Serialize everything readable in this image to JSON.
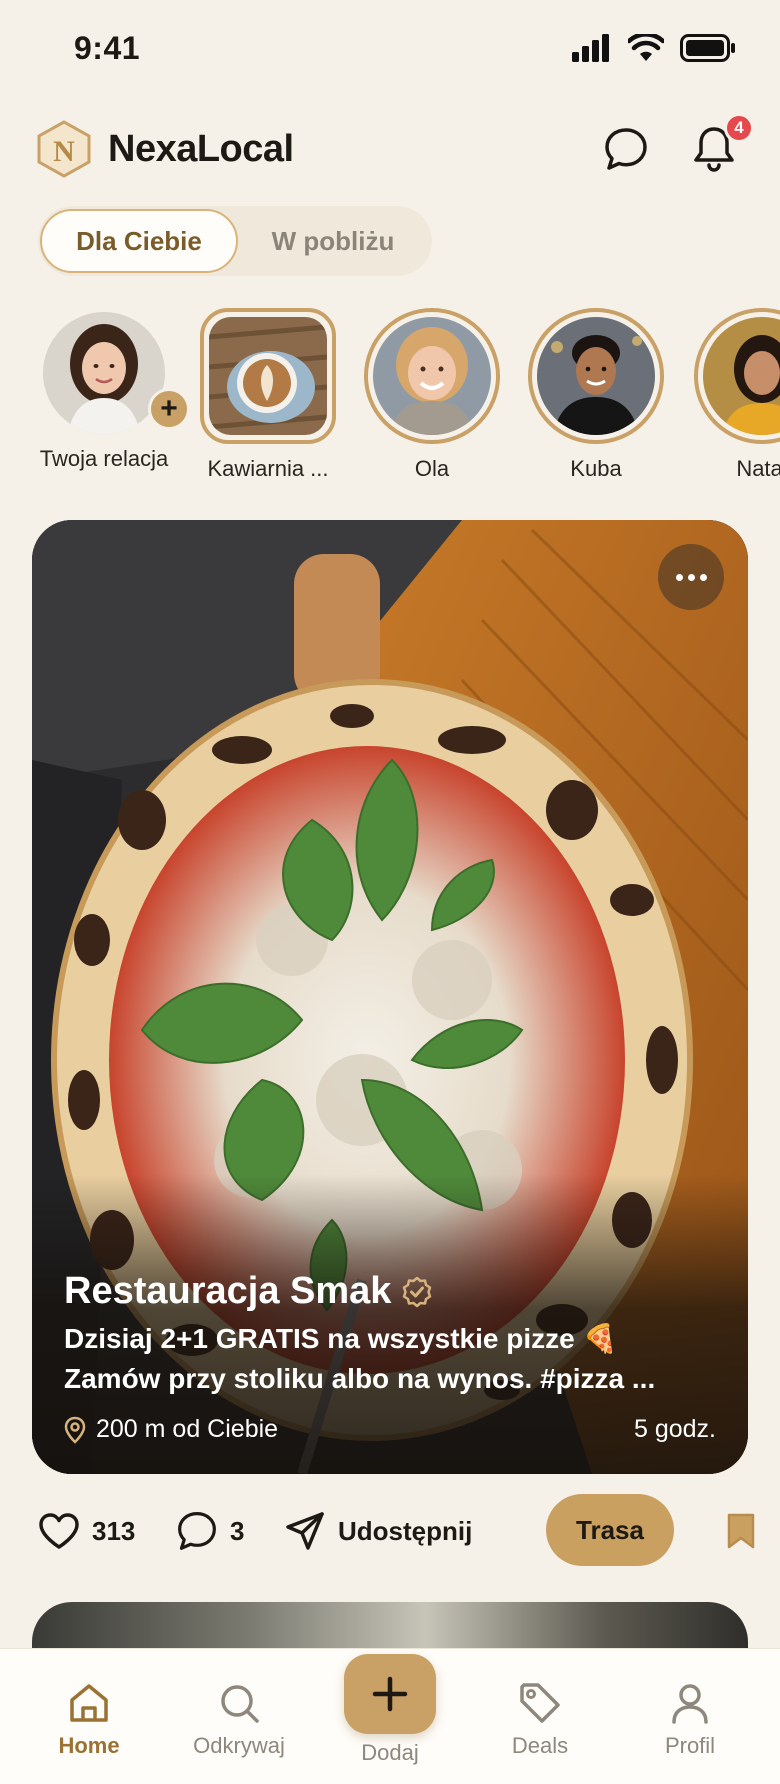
{
  "status_bar": {
    "time": "9:41"
  },
  "header": {
    "app_name": "NexaLocal",
    "logo_letter": "N",
    "notifications_count": "4"
  },
  "tabs": [
    {
      "label": "Dla Ciebie",
      "active": true
    },
    {
      "label": "W pobliżu",
      "active": false
    }
  ],
  "stories": [
    {
      "label": "Twoja relacja",
      "own": true
    },
    {
      "label": "Kawiarnia ..."
    },
    {
      "label": "Ola"
    },
    {
      "label": "Kuba"
    },
    {
      "label": "Natal"
    }
  ],
  "post": {
    "title": "Restauracja Smak",
    "line1": "Dzisiaj 2+1 GRATIS na wszystkie pizze 🍕",
    "line2": "Zamów przy stoliku albo na wynos. #pizza ...",
    "distance": "200 m od Ciebie",
    "time_ago": "5 godz."
  },
  "actions": {
    "likes": "313",
    "comments": "3",
    "share_label": "Udostępnij",
    "route_label": "Trasa"
  },
  "nav": {
    "home": "Home",
    "explore": "Odkrywaj",
    "add": "Dodaj",
    "deals": "Deals",
    "profile": "Profil"
  },
  "colors": {
    "accent": "#c9a065",
    "accent_dark": "#9a7233",
    "background": "#f6f1e8",
    "badge": "#e5484d"
  }
}
